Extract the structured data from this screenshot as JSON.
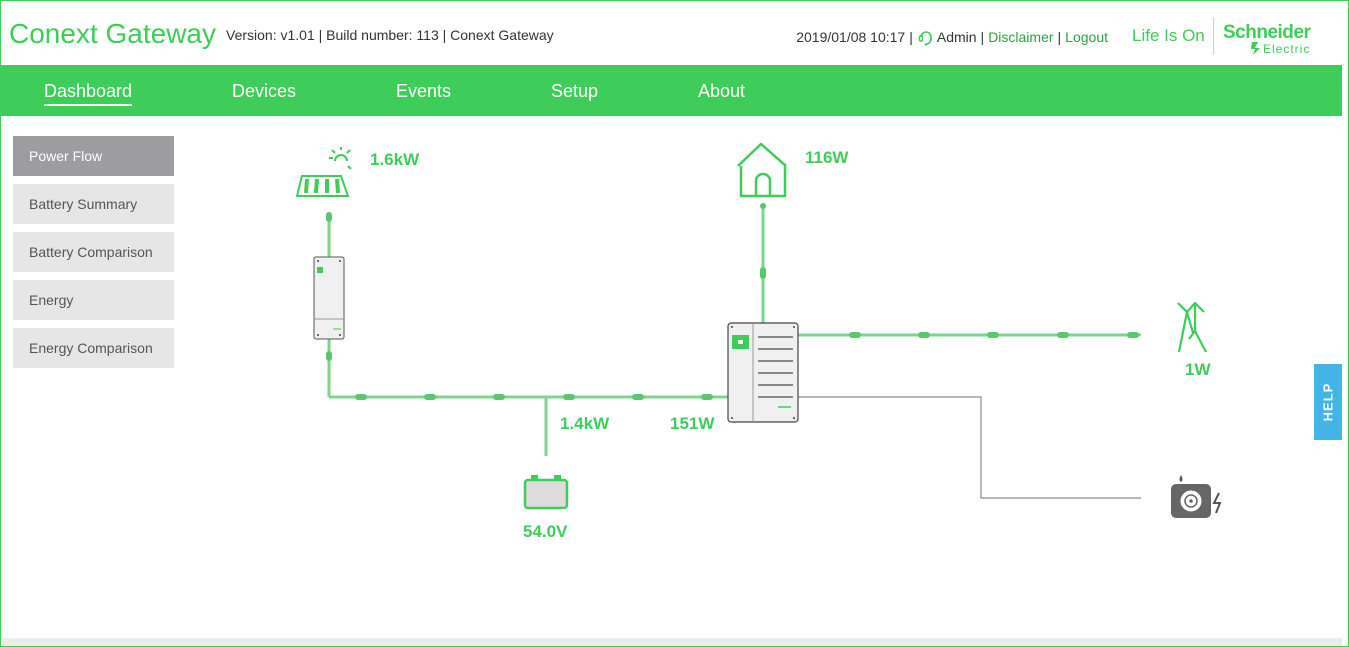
{
  "header": {
    "app_title": "Conext Gateway",
    "version_info": "Version: v1.01 | Build number: 113 | Conext Gateway",
    "datetime": "2019/01/08 10:17",
    "user": "Admin",
    "disclaimer": "Disclaimer",
    "logout": "Logout",
    "separator": "|",
    "tagline": "Life Is On",
    "brand_name": "Schneider",
    "brand_sub": "Electric",
    "icons": {
      "user": "user-headset-icon",
      "brand": "schneider-logo-icon"
    }
  },
  "nav": {
    "items": [
      {
        "label": "Dashboard",
        "active": true
      },
      {
        "label": "Devices",
        "active": false
      },
      {
        "label": "Events",
        "active": false
      },
      {
        "label": "Setup",
        "active": false
      },
      {
        "label": "About",
        "active": false
      }
    ]
  },
  "sidebar": {
    "items": [
      {
        "label": "Power Flow",
        "active": true
      },
      {
        "label": "Battery Summary",
        "active": false
      },
      {
        "label": "Battery Comparison",
        "active": false
      },
      {
        "label": "Energy",
        "active": false
      },
      {
        "label": "Energy Comparison",
        "active": false
      }
    ]
  },
  "power_flow": {
    "solar_power": "1.6kW",
    "load_power": "116W",
    "grid_power": "1W",
    "battery_power": "1.4kW",
    "inverter_power": "151W",
    "battery_voltage": "54.0V",
    "icons": {
      "solar": "solar-panel-icon",
      "charge_controller": "charge-controller-icon",
      "load": "house-icon",
      "inverter": "inverter-icon",
      "grid": "grid-tower-icon",
      "battery": "battery-icon",
      "generator": "generator-icon"
    }
  },
  "help": {
    "label": "HELP"
  },
  "colors": {
    "accent": "#3dcd58",
    "help": "#42b4e6",
    "sidebar_active": "#9d9d9f",
    "sidebar_bg": "#e6e6e6"
  }
}
